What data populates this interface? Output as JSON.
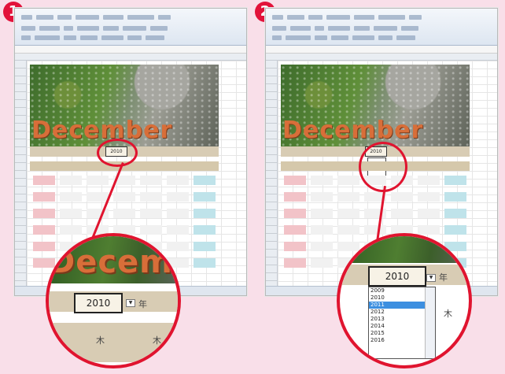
{
  "steps": [
    "1",
    "2"
  ],
  "month_label": "December",
  "year_value": "2010",
  "year_suffix": "年",
  "weekday_sample": "木",
  "dropdown_options": [
    "2009",
    "2010",
    "2011",
    "2012",
    "2013",
    "2014",
    "2015",
    "2016"
  ],
  "dropdown_selected": "2011",
  "colors": {
    "background": "#f9dfe9",
    "accent_red": "#e0142f",
    "month_text": "#d86e39",
    "header_band": "#d8ccb4",
    "sunday_cell": "#f2c3c8",
    "saturday_cell": "#bfe3ea",
    "selection": "#3c8fe0"
  }
}
